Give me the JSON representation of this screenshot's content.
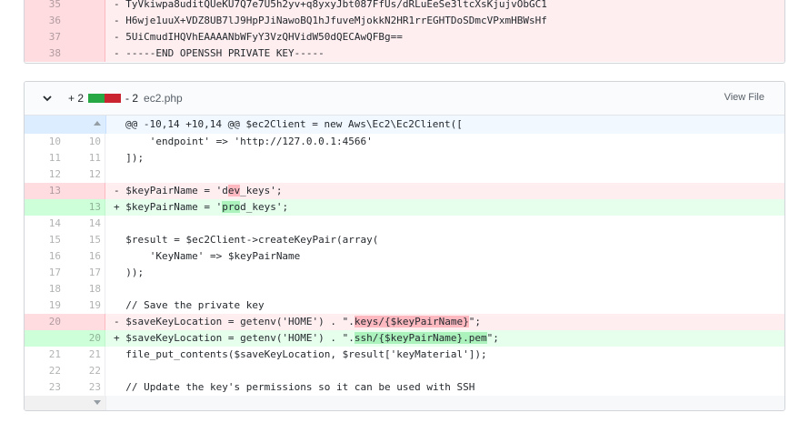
{
  "prev_file": {
    "lines": [
      {
        "old": "35",
        "new": "",
        "type": "del",
        "sign": "-",
        "parts": [
          {
            "t": "TyVkiwpa8uditQUeKU7Q7e7U5h2yv+q8yxyJbt087FfUs/dRLuEeSe3ltcXsKjujvObGC1"
          }
        ]
      },
      {
        "old": "36",
        "new": "",
        "type": "del",
        "sign": "-",
        "parts": [
          {
            "t": "H6wje1uuX+VDZ8UB7lJ9HpPJiNawoBQ1hJfuveMjokkN2HR1rrEGHTDoSDmcVPxmHBWsHf"
          }
        ]
      },
      {
        "old": "37",
        "new": "",
        "type": "del",
        "sign": "-",
        "parts": [
          {
            "t": "5UiCmudIHQVhEAAAANbWFyY3VzQHVidW50dQECAwQFBg=="
          }
        ]
      },
      {
        "old": "38",
        "new": "",
        "type": "del",
        "sign": "-",
        "parts": [
          {
            "t": "-----END OPENSSH PRIVATE KEY-----"
          }
        ]
      }
    ]
  },
  "main_file": {
    "stat_add": "+ 2",
    "stat_del": "- 2",
    "file_name": "ec2.php",
    "view_file_label": "View File",
    "hunk_header": "@@ -10,14 +10,14 @@ $ec2Client = new Aws\\Ec2\\Ec2Client([",
    "lines": [
      {
        "old": "10",
        "new": "10",
        "type": "ctx",
        "sign": " ",
        "parts": [
          {
            "t": "    'endpoint' => 'http://127.0.0.1:4566'"
          }
        ]
      },
      {
        "old": "11",
        "new": "11",
        "type": "ctx",
        "sign": " ",
        "parts": [
          {
            "t": "]);"
          }
        ]
      },
      {
        "old": "12",
        "new": "12",
        "type": "ctx",
        "sign": " ",
        "parts": [
          {
            "t": ""
          }
        ]
      },
      {
        "old": "13",
        "new": "",
        "type": "del",
        "sign": "-",
        "parts": [
          {
            "t": "$keyPairName = 'd"
          },
          {
            "t": "ev",
            "hl": true
          },
          {
            "t": "_keys';"
          }
        ]
      },
      {
        "old": "",
        "new": "13",
        "type": "add",
        "sign": "+",
        "parts": [
          {
            "t": "$keyPairName = '"
          },
          {
            "t": "pro",
            "hl": true
          },
          {
            "t": "d_keys';"
          }
        ]
      },
      {
        "old": "14",
        "new": "14",
        "type": "ctx",
        "sign": " ",
        "parts": [
          {
            "t": ""
          }
        ]
      },
      {
        "old": "15",
        "new": "15",
        "type": "ctx",
        "sign": " ",
        "parts": [
          {
            "t": "$result = $ec2Client->createKeyPair(array("
          }
        ]
      },
      {
        "old": "16",
        "new": "16",
        "type": "ctx",
        "sign": " ",
        "parts": [
          {
            "t": "    'KeyName' => $keyPairName"
          }
        ]
      },
      {
        "old": "17",
        "new": "17",
        "type": "ctx",
        "sign": " ",
        "parts": [
          {
            "t": "));"
          }
        ]
      },
      {
        "old": "18",
        "new": "18",
        "type": "ctx",
        "sign": " ",
        "parts": [
          {
            "t": ""
          }
        ]
      },
      {
        "old": "19",
        "new": "19",
        "type": "ctx",
        "sign": " ",
        "parts": [
          {
            "t": "// Save the private key"
          }
        ]
      },
      {
        "old": "20",
        "new": "",
        "type": "del",
        "sign": "-",
        "parts": [
          {
            "t": "$saveKeyLocation = getenv('HOME') . \"."
          },
          {
            "t": "keys/{$keyPairName}",
            "hl": true
          },
          {
            "t": "\";"
          }
        ]
      },
      {
        "old": "",
        "new": "20",
        "type": "add",
        "sign": "+",
        "parts": [
          {
            "t": "$saveKeyLocation = getenv('HOME') . \"."
          },
          {
            "t": "ssh/{$keyPairName}.pem",
            "hl": true
          },
          {
            "t": "\";"
          }
        ]
      },
      {
        "old": "21",
        "new": "21",
        "type": "ctx",
        "sign": " ",
        "parts": [
          {
            "t": "file_put_contents($saveKeyLocation, $result['keyMaterial']);"
          }
        ]
      },
      {
        "old": "22",
        "new": "22",
        "type": "ctx",
        "sign": " ",
        "parts": [
          {
            "t": ""
          }
        ]
      },
      {
        "old": "23",
        "new": "23",
        "type": "ctx",
        "sign": " ",
        "parts": [
          {
            "t": "// Update the key's permissions so it can be used with SSH"
          }
        ]
      }
    ]
  },
  "icons": {
    "collapse": "chevron-down-icon",
    "expand_up": "expand-up-icon",
    "expand_down": "expand-down-icon"
  },
  "colors": {
    "del_bg": "#ffeef0",
    "add_bg": "#e6ffed",
    "del_hl": "#fdb8c0",
    "add_hl": "#acf2bd",
    "stat_add": "#28a745",
    "stat_del": "#cb2431"
  }
}
